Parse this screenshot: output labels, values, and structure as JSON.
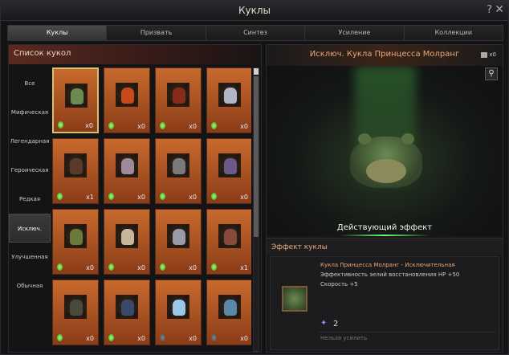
{
  "window": {
    "title": "Куклы",
    "help_icon": "?",
    "close_icon": "✕"
  },
  "tabs": [
    {
      "label": "Куклы",
      "active": true
    },
    {
      "label": "Призвать",
      "active": false
    },
    {
      "label": "Синтез",
      "active": false
    },
    {
      "label": "Усиление",
      "active": false
    },
    {
      "label": "Коллекции",
      "active": false
    }
  ],
  "doll_list": {
    "header": "Список кукол",
    "filters": [
      {
        "label": "Все",
        "active": false
      },
      {
        "label": "Мифическая",
        "active": false
      },
      {
        "label": "Легендарная",
        "active": false
      },
      {
        "label": "Героическая",
        "active": false
      },
      {
        "label": "Редкая",
        "active": false
      },
      {
        "label": "Исключ.",
        "active": true
      },
      {
        "label": "Улучшенная",
        "active": false
      },
      {
        "label": "Обычная",
        "active": false
      }
    ],
    "cards": [
      {
        "count": "x0",
        "gem": "green",
        "selected": true,
        "color": "#6a8a52"
      },
      {
        "count": "x0",
        "gem": "green",
        "selected": false,
        "color": "#c84a1a"
      },
      {
        "count": "x0",
        "gem": "green",
        "selected": false,
        "color": "#8a2a1a"
      },
      {
        "count": "x0",
        "gem": "green",
        "selected": false,
        "color": "#b0b8c8"
      },
      {
        "count": "x1",
        "gem": "green",
        "selected": false,
        "color": "#5a3a2a"
      },
      {
        "count": "x0",
        "gem": "green",
        "selected": false,
        "color": "#a08a9a"
      },
      {
        "count": "x0",
        "gem": "green",
        "selected": false,
        "color": "#7a7a7a"
      },
      {
        "count": "x0",
        "gem": "green",
        "selected": false,
        "color": "#6a5a8a"
      },
      {
        "count": "x0",
        "gem": "green",
        "selected": false,
        "color": "#6a7a3a"
      },
      {
        "count": "x0",
        "gem": "green",
        "selected": false,
        "color": "#c8b89a"
      },
      {
        "count": "x0",
        "gem": "green",
        "selected": false,
        "color": "#9a9aa8"
      },
      {
        "count": "x1",
        "gem": "green",
        "selected": false,
        "color": "#8a4a3a"
      },
      {
        "count": "x0",
        "gem": "green",
        "selected": false,
        "color": "#4a4a3a"
      },
      {
        "count": "x0",
        "gem": "green",
        "selected": false,
        "color": "#3a4a6a"
      },
      {
        "count": "x0",
        "gem": "grey",
        "selected": false,
        "color": "#9ac8e8"
      },
      {
        "count": "x0",
        "gem": "grey",
        "selected": false,
        "color": "#5a8aa8"
      }
    ]
  },
  "detail": {
    "title": "Исключ. Кукла Принцесса Молранг",
    "owned_count": "x0",
    "active_effect_label": "Действующий эффект",
    "effect_header": "Эффект куклы",
    "effect_name": "Кукла Принцесса Молранг - Исключительная",
    "effect_lines": [
      "Эффективность зелий восстановления HP +50",
      "Скорость +5"
    ],
    "enhancement_value": "2",
    "cannot_enhance": "Нельзя усилить"
  }
}
